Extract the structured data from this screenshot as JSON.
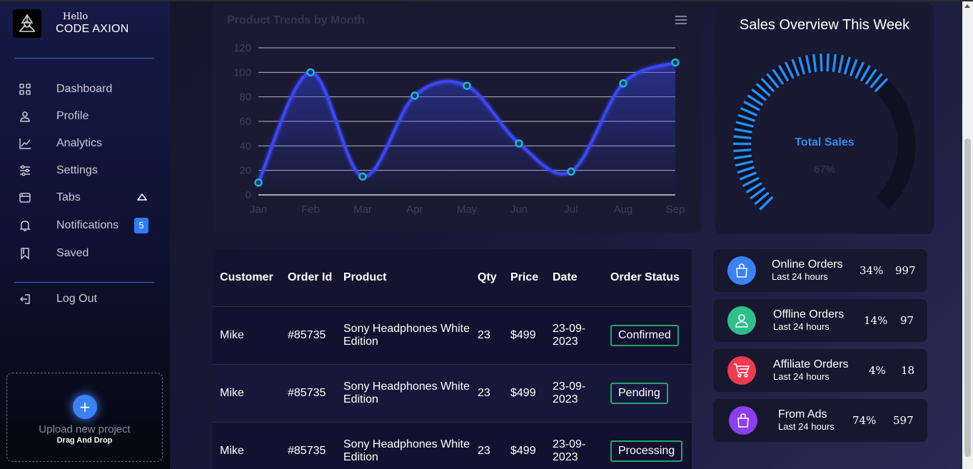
{
  "brand": {
    "greeting": "Hello",
    "name": "CODE AXION"
  },
  "sidebar": {
    "items": [
      {
        "label": "Dashboard",
        "icon": "grid-icon"
      },
      {
        "label": "Profile",
        "icon": "user-icon"
      },
      {
        "label": "Analytics",
        "icon": "chart-line-icon"
      },
      {
        "label": "Settings",
        "icon": "sliders-icon"
      },
      {
        "label": "Tabs",
        "icon": "browser-tabs-icon"
      },
      {
        "label": "Notifications",
        "icon": "bell-icon",
        "badge": "5"
      },
      {
        "label": "Saved",
        "icon": "bookmark-icon"
      }
    ],
    "logout": {
      "label": "Log Out",
      "icon": "logout-icon"
    },
    "upload": {
      "title": "Upload new project",
      "subtitle": "Drag And Drop"
    }
  },
  "trend_chart": {
    "title": "Product Trends by Month"
  },
  "chart_data": {
    "type": "area",
    "title": "Product Trends by Month",
    "categories": [
      "Jan",
      "Feb",
      "Mar",
      "Apr",
      "May",
      "Jun",
      "Jul",
      "Aug",
      "Sep"
    ],
    "series": [
      {
        "values": [
          10,
          100,
          15,
          81,
          89,
          42,
          19,
          91,
          108
        ]
      }
    ],
    "ylim": [
      0,
      120
    ],
    "yticks": [
      0,
      20,
      40,
      60,
      80,
      100,
      120
    ],
    "grid": true,
    "line_color": "#3b47f5",
    "point_color": "#1fb2e0"
  },
  "gauge": {
    "title": "Sales Overview This Week",
    "label": "Total Sales",
    "value_text": "67%",
    "value": 67,
    "color": "#1e90ff"
  },
  "orders_table": {
    "columns": [
      "Customer",
      "Order Id",
      "Product",
      "Qty",
      "Price",
      "Date",
      "Order Status"
    ],
    "rows": [
      {
        "customer": "Mike",
        "order_id": "#85735",
        "product": "Sony Headphones White Edition",
        "qty": "23",
        "price": "$499",
        "date": "23-09-2023",
        "status": "Confirmed"
      },
      {
        "customer": "Mike",
        "order_id": "#85735",
        "product": "Sony Headphones White Edition",
        "qty": "23",
        "price": "$499",
        "date": "23-09-2023",
        "status": "Pending"
      },
      {
        "customer": "Mike",
        "order_id": "#85735",
        "product": "Sony Headphones White Edition",
        "qty": "23",
        "price": "$499",
        "date": "23-09-2023",
        "status": "Processing"
      }
    ]
  },
  "stats": [
    {
      "name": "Online Orders",
      "sub": "Last 24 hours",
      "pct": "34%",
      "count": "997",
      "icon": "shopping-bag-icon",
      "color": "#3b82f6"
    },
    {
      "name": "Offline Orders",
      "sub": "Last 24 hours",
      "pct": "14%",
      "count": "97",
      "icon": "user-icon",
      "color": "#2fbf8a"
    },
    {
      "name": "Affiliate Orders",
      "sub": "Last 24 hours",
      "pct": "4%",
      "count": "18",
      "icon": "shopping-cart-icon",
      "color": "#ef3b4f"
    },
    {
      "name": "From Ads",
      "sub": "Last 24 hours",
      "pct": "74%",
      "count": "597",
      "icon": "shopping-bag-icon",
      "color": "#8b3ff0"
    }
  ]
}
